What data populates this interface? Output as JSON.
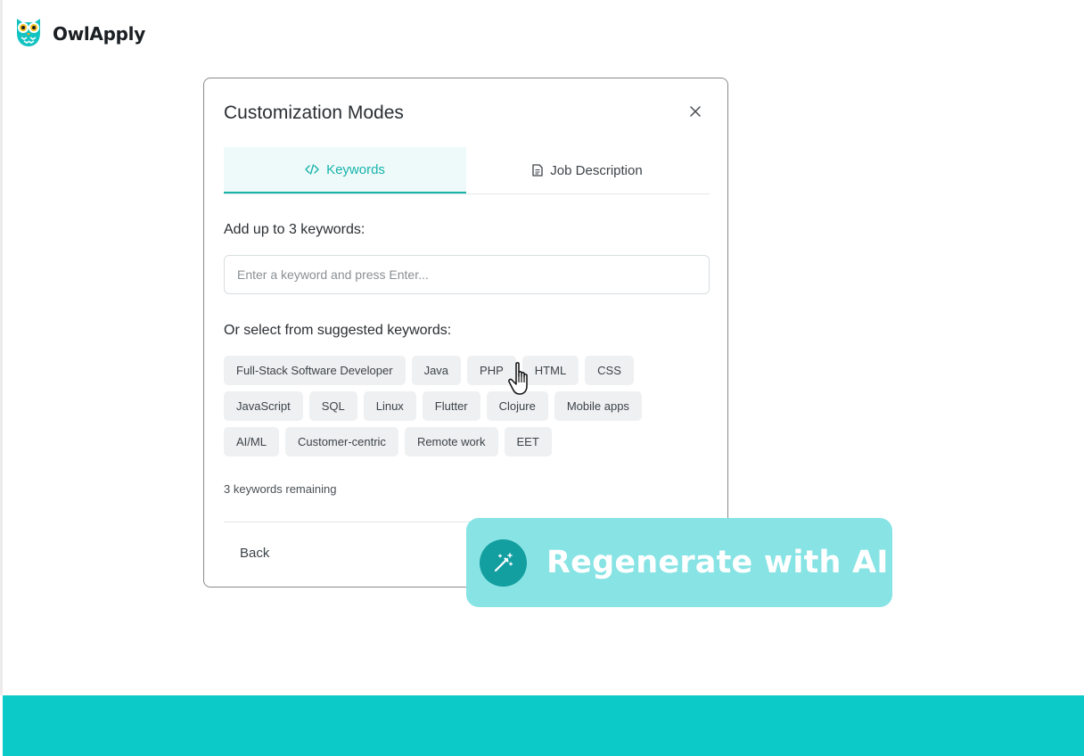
{
  "brand": {
    "name": "OwlApply"
  },
  "modal": {
    "title": "Customization Modes",
    "tabs": [
      {
        "label": "Keywords",
        "icon": "code-icon",
        "active": true
      },
      {
        "label": "Job Description",
        "icon": "document-icon",
        "active": false
      }
    ],
    "add_label": "Add up to 3 keywords:",
    "input_placeholder": "Enter a keyword and press Enter...",
    "suggest_label": "Or select from suggested keywords:",
    "suggested_keywords": [
      [
        "Full-Stack Software Developer",
        "Java",
        "PHP",
        "HTML",
        "CSS"
      ],
      [
        "JavaScript",
        "SQL",
        "Linux",
        "Flutter",
        "Clojure",
        "Mobile apps"
      ],
      [
        "AI/ML",
        "Customer-centric",
        "Remote work",
        "EET"
      ]
    ],
    "remaining_text": "3 keywords remaining",
    "back_label": "Back"
  },
  "regenerate": {
    "label": "Regenerate with AI",
    "icon": "magic-wand-icon"
  },
  "colors": {
    "accent": "#17b3ab",
    "regen_bg": "#87e3e4",
    "regen_icon_bg": "#139ea0",
    "bottom_band": "#0ccac8",
    "chip_bg": "#eef0f2"
  }
}
